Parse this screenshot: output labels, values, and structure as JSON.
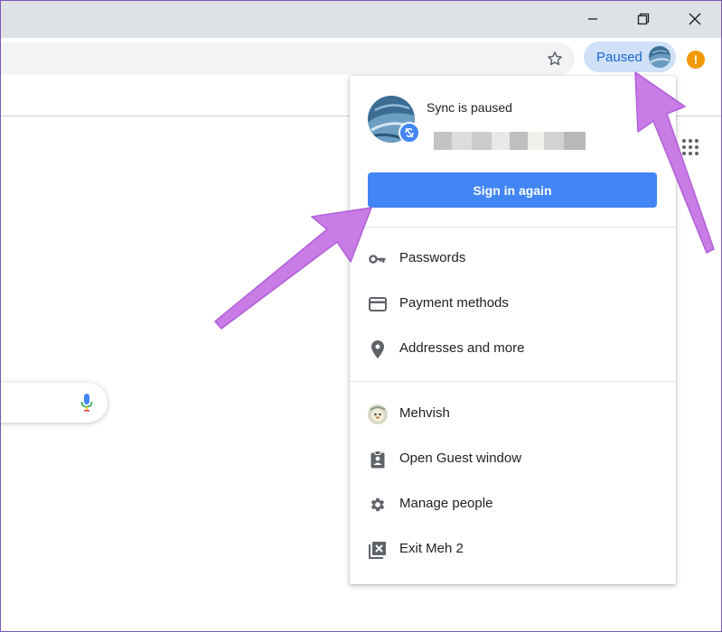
{
  "toolbar": {
    "profile_chip_label": "Paused"
  },
  "menu": {
    "sync_title": "Sync is paused",
    "sign_in_button": "Sign in again",
    "items": [
      {
        "label": "Passwords",
        "icon": "key-icon"
      },
      {
        "label": "Payment methods",
        "icon": "credit-card-icon"
      },
      {
        "label": "Addresses and more",
        "icon": "location-pin-icon"
      }
    ],
    "people": [
      {
        "label": "Mehvish",
        "icon": "avatar"
      },
      {
        "label": "Open Guest window",
        "icon": "guest-badge-icon"
      },
      {
        "label": "Manage people",
        "icon": "gear-icon"
      },
      {
        "label": "Exit Meh 2",
        "icon": "exit-window-icon"
      }
    ]
  },
  "colors": {
    "accent": "#4285f4",
    "chip_bg": "#cfe0f8",
    "annotation_arrow": "#c97be6",
    "alert": "#f29900"
  }
}
